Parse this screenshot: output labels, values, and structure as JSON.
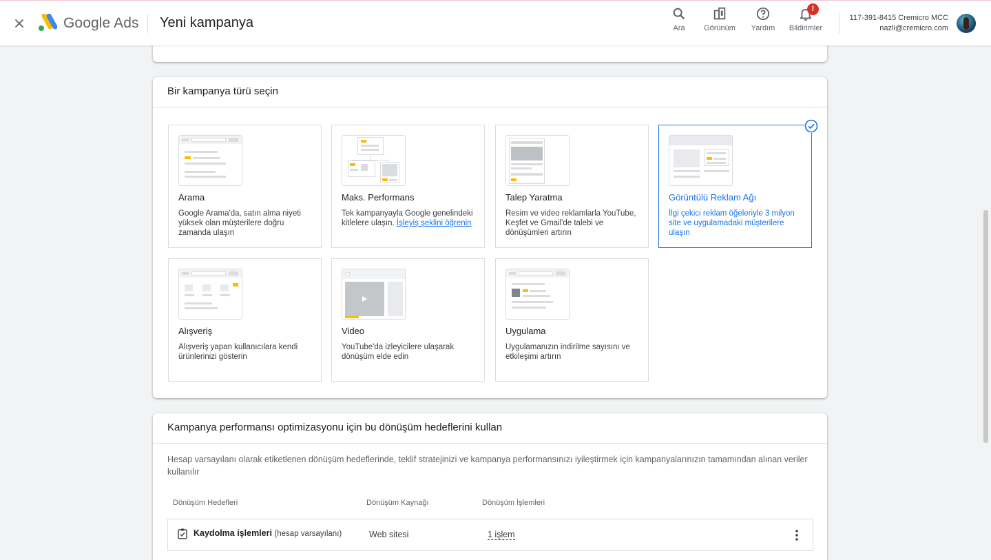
{
  "header": {
    "brand_google": "Google",
    "brand_ads": "Ads",
    "page_title": "Yeni kampanya",
    "tools": {
      "search": "Ara",
      "view": "Görünüm",
      "help": "Yardım",
      "notifications": "Bildirimler",
      "notification_badge": "!"
    },
    "account_line1": "117-391-8415 Cremicro MCC",
    "account_line2": "nazli@cremicro.com"
  },
  "campaign_type": {
    "heading": "Bir kampanya türü seçin",
    "tiles": [
      {
        "title": "Arama",
        "desc": "Google Arama'da, satın alma niyeti yüksek olan müşterilere doğru zamanda ulaşın"
      },
      {
        "title": "Maks. Performans",
        "desc": "Tek kampanyayla Google genelindeki kitlelere ulaşın.",
        "link": "İşleyiş şeklini öğrenin"
      },
      {
        "title": "Talep Yaratma",
        "desc": "Resim ve video reklamlarla YouTube, Keşfet ve Gmail'de talebi ve dönüşümleri artırın"
      },
      {
        "title": "Görüntülü Reklam Ağı",
        "desc": "İlgi çekici reklam öğeleriyle 3 milyon site ve uygulamadaki müşterilere ulaşın",
        "selected": true
      },
      {
        "title": "Alışveriş",
        "desc": "Alışveriş yapan kullanıcılara kendi ürünlerinizi gösterin"
      },
      {
        "title": "Video",
        "desc": "YouTube'da izleyicilere ulaşarak dönüşüm elde edin"
      },
      {
        "title": "Uygulama",
        "desc": "Uygulamanızın indirilme sayısını ve etkileşimi artırın"
      }
    ]
  },
  "goals": {
    "heading": "Kampanya performansı optimizasyonu için bu dönüşüm hedeflerini kullan",
    "description": "Hesap varsayılanı olarak etiketlenen dönüşüm hedeflerinde, teklif stratejinizi ve kampanya performansınızı iyileştirmek için kampanyalarınızın tamamından alınan veriler kullanılır",
    "columns": [
      "Dönüşüm Hedefleri",
      "Dönüşüm Kaynağı",
      "Dönüşüm İşlemleri"
    ],
    "rows": [
      {
        "name": "Kaydolma işlemleri",
        "default_label": "(hesap varsayılanı)",
        "source": "Web sitesi",
        "actions": "1 işlem"
      }
    ]
  },
  "colors": {
    "accent": "#1a73e8",
    "yellow": "#fbbc04",
    "badge": "#d93025"
  }
}
